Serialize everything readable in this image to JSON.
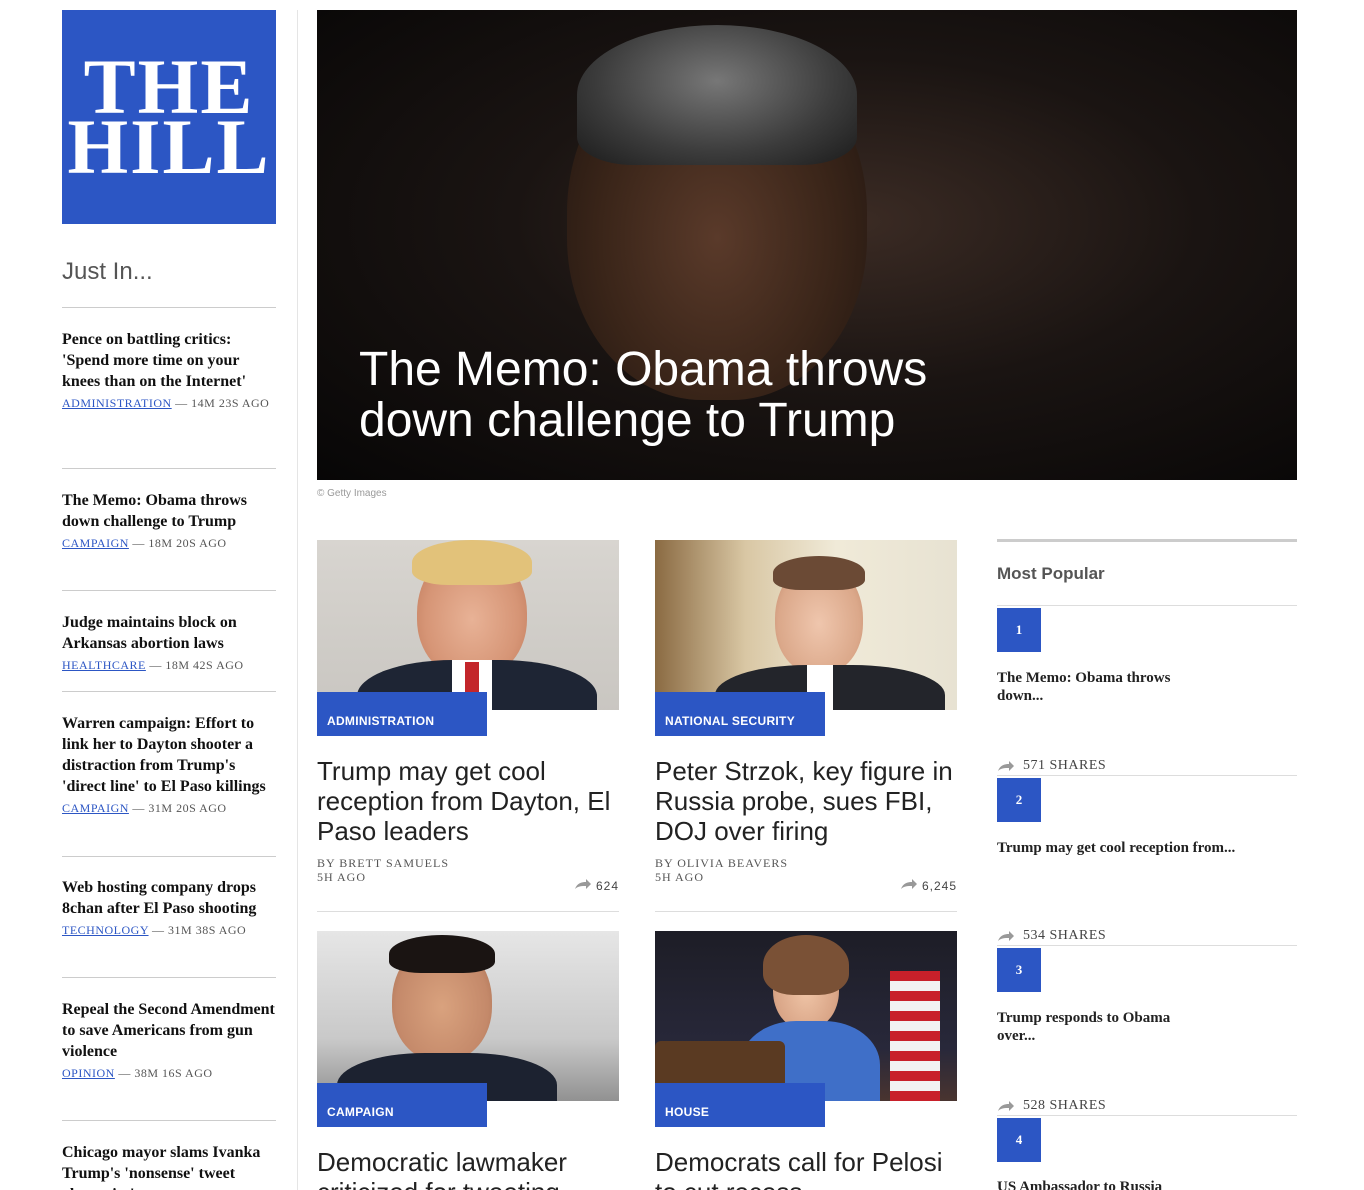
{
  "logo": {
    "line1": "THE",
    "line2": "HILL"
  },
  "just_in": {
    "heading": "Just In...",
    "items": [
      {
        "title": "Pence on battling critics: 'Spend more time on your knees than on the Internet'",
        "category": "ADMINISTRATION",
        "time": " — 14M 23S AGO"
      },
      {
        "title": "The Memo: Obama throws down challenge to Trump",
        "category": "CAMPAIGN",
        "time": " — 18M 20S AGO"
      },
      {
        "title": "Judge maintains block on Arkansas abortion laws",
        "category": "HEALTHCARE",
        "time": " — 18M 42S AGO"
      },
      {
        "title": "Warren campaign: Effort to link her to Dayton shooter a distraction from Trump's 'direct line' to El Paso killings",
        "category": "CAMPAIGN",
        "time": " — 31M 20S AGO"
      },
      {
        "title": "Web hosting company drops 8chan after El Paso shooting",
        "category": "TECHNOLOGY",
        "time": " — 31M 38S AGO"
      },
      {
        "title": "Repeal the Second Amendment to save Americans from gun violence",
        "category": "OPINION",
        "time": " — 38M 16S AGO"
      },
      {
        "title": "Chicago mayor slams Ivanka Trump's 'nonsense' tweet about city's...",
        "category": "",
        "time": ""
      }
    ]
  },
  "hero": {
    "title": "The Memo: Obama throws down challenge to Trump",
    "credit": "© Getty Images"
  },
  "cards": [
    {
      "category": "ADMINISTRATION",
      "title": "Trump may get cool reception from Dayton, El Paso leaders",
      "byline": "BY BRETT SAMUELS",
      "time": "5H AGO",
      "shares": "624"
    },
    {
      "category": "NATIONAL SECURITY",
      "title": "Peter Strzok, key figure in Russia probe, sues FBI, DOJ over firing",
      "byline": "BY OLIVIA BEAVERS",
      "time": "5H AGO",
      "shares": "6,245"
    },
    {
      "category": "CAMPAIGN",
      "title": "Democratic lawmaker criticized for tweeting",
      "byline": "",
      "time": "",
      "shares": ""
    },
    {
      "category": "HOUSE",
      "title": "Democrats call for Pelosi to cut recess",
      "byline": "",
      "time": "",
      "shares": ""
    }
  ],
  "most_popular": {
    "heading": "Most Popular",
    "items": [
      {
        "rank": "1",
        "title": "The Memo: Obama throws down...",
        "shares": "571 SHARES"
      },
      {
        "rank": "2",
        "title": "Trump may get cool reception from...",
        "shares": "534 SHARES"
      },
      {
        "rank": "3",
        "title": "Trump responds to Obama over...",
        "shares": "528 SHARES"
      },
      {
        "rank": "4",
        "title": "US Ambassador to Russia",
        "shares": ""
      }
    ]
  },
  "colors": {
    "brand": "#2c56c4"
  }
}
